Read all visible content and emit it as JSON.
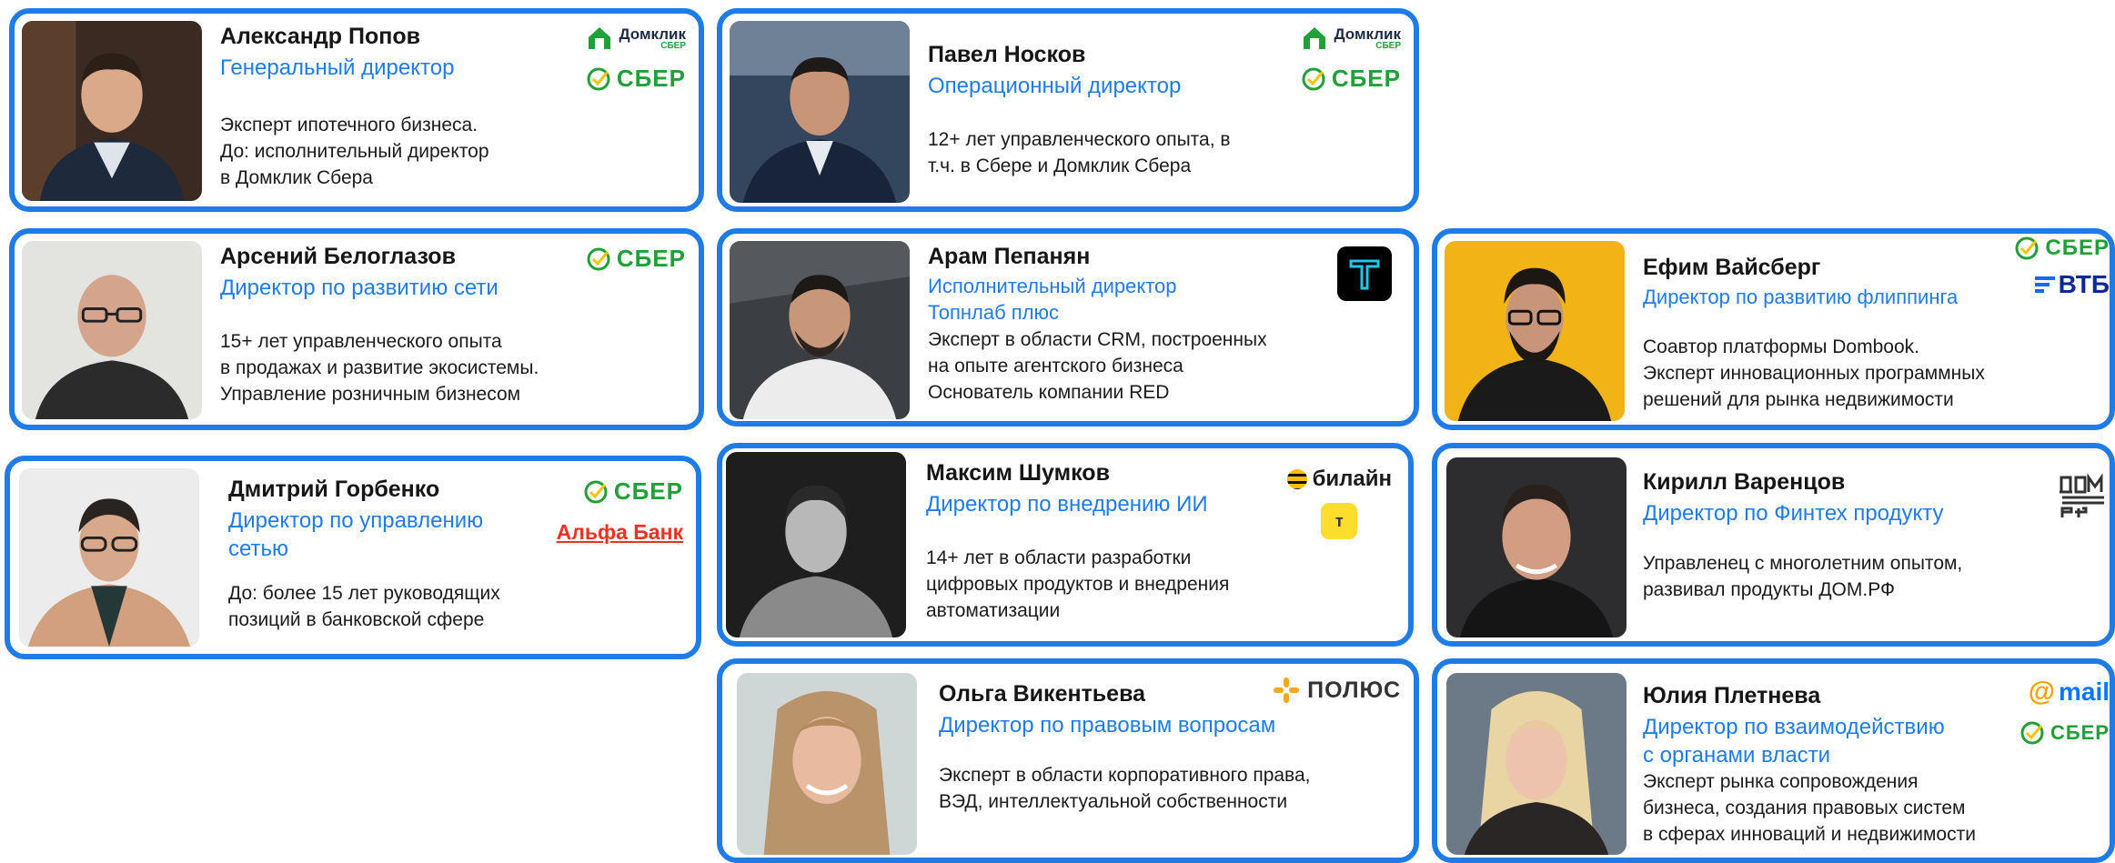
{
  "colors": {
    "accent": "#1f7be6",
    "sber_green": "#21a038",
    "alfa_red": "#ef3124",
    "vtb_blue": "#0a2896"
  },
  "people": [
    {
      "name": "Александр Попов",
      "role": [
        "Генеральный директор"
      ],
      "bio": [
        "Эксперт ипотечного бизнеса.",
        "До: исполнительный директор",
        "в Домклик Сбера"
      ],
      "logos": [
        "domclick-logo",
        "sber-logo"
      ]
    },
    {
      "name": "Павел Носков",
      "role": [
        " Операционный директор"
      ],
      "bio": [
        "12+ лет управленческого опыта, в",
        "т.ч. в Сбере и Домклик Сбера"
      ],
      "logos": [
        "domclick-logo",
        "sber-logo"
      ]
    },
    {
      "name": "Арсений Белоглазов",
      "role": [
        "Директор по развитию сети"
      ],
      "bio": [
        "15+ лет управленческого опыта",
        "в продажах и развитие экосистемы.",
        "Управление розничным бизнесом"
      ],
      "logos": [
        "sber-logo"
      ]
    },
    {
      "name": "Арам Пепанян",
      "role": [
        "Исполнительный директор",
        "Топнлаб плюс"
      ],
      "bio": [
        "Эксперт в области CRM, построенных",
        "на опыте агентского бизнеса",
        "Основатель компании RED"
      ],
      "logos": [
        "toplab-logo"
      ]
    },
    {
      "name": "Ефим Вайсберг",
      "role": [
        "Директор по развитию флиппинга"
      ],
      "bio": [
        "Соавтор платформы Dombook.",
        "Эксперт инновационных программных",
        "решений для рынка недвижимости"
      ],
      "logos": [
        "sber-logo",
        "vtb-logo"
      ]
    },
    {
      "name": "Дмитрий Горбенко",
      "role": [
        "Директор по управлению",
        "сетью"
      ],
      "bio": [
        "До: более 15 лет руководящих",
        "позиций  в банковской сфере"
      ],
      "logos": [
        "sber-logo",
        "alfa-bank-logo"
      ]
    },
    {
      "name": "Максим Шумков",
      "role": [
        "Директор по внедрению ИИ"
      ],
      "bio": [
        "14+ лет в области разработки",
        "цифровых продуктов и внедрения",
        "автоматизации"
      ],
      "logos": [
        "beeline-logo",
        "tinkoff-logo"
      ]
    },
    {
      "name": "Кирилл Варенцов",
      "role": [
        "Директор по Финтех продукту"
      ],
      "bio": [
        "Управленец с многолетним опытом,",
        "развивал продукты ДОМ.РФ"
      ],
      "logos": [
        "domrf-logo"
      ]
    },
    {
      "name": "Ольга Викентьева",
      "role": [
        "Директор по правовым вопросам"
      ],
      "bio": [
        "Эксперт в области корпоративного права,",
        "ВЭД, интеллектуальной собственности"
      ],
      "logos": [
        "polus-logo"
      ]
    },
    {
      "name": "Юлия Плетнева",
      "role": [
        "Директор по взаимодействию",
        "с органами власти"
      ],
      "bio": [
        "Эксперт рынка сопровождения",
        "бизнеса, создания правовых систем",
        "в сферах инноваций и недвижимости"
      ],
      "logos": [
        "mail-logo",
        "sber-logo"
      ]
    }
  ],
  "logo_text": {
    "sber": "СБЕР",
    "domclick": "Домклик",
    "domclick_sub": "СБЕР",
    "alfa": "Альфа Банк",
    "vtb": "ВТБ",
    "beeline": "билайн",
    "tinkoff": "т",
    "polus": "ПОЛЮС",
    "mail": "mail"
  }
}
